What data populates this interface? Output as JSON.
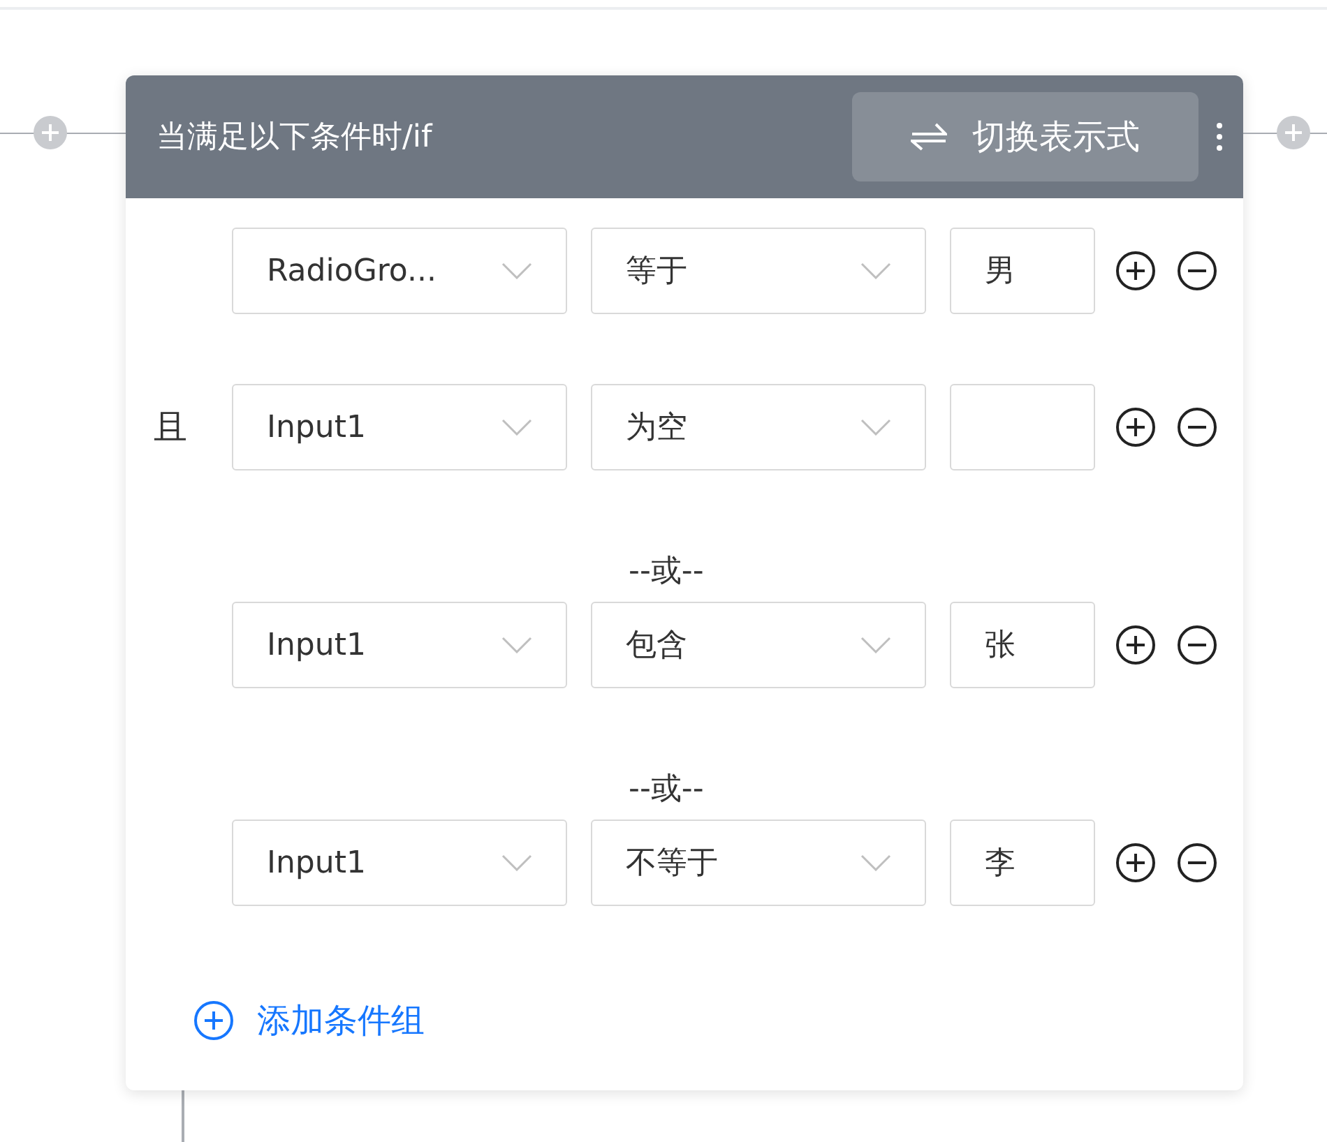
{
  "header": {
    "title": "当满足以下条件时/if",
    "toggle_button": "切换表示式"
  },
  "groups": [
    {
      "conditions": [
        {
          "field": "RadioGro...",
          "operator": "等于",
          "value": "男"
        },
        {
          "logic_label": "且",
          "field": "Input1",
          "operator": "为空"
        }
      ]
    },
    {
      "or_label": "--或--",
      "conditions": [
        {
          "field": "Input1",
          "operator": "包含",
          "value": "张"
        }
      ]
    },
    {
      "or_label": "--或--",
      "conditions": [
        {
          "field": "Input1",
          "operator": "不等于",
          "value": "李"
        }
      ]
    }
  ],
  "add_group": "添加条件组"
}
